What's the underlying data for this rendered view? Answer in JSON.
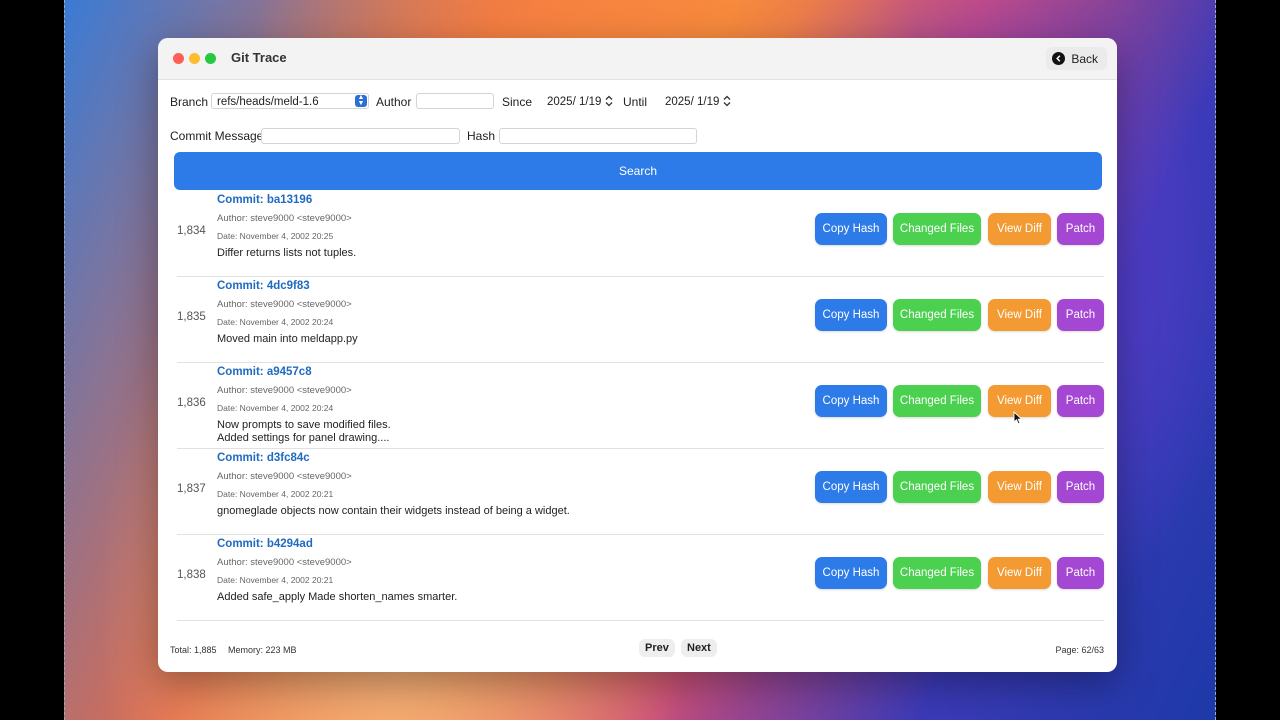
{
  "window": {
    "title": "Git Trace",
    "back_label": "Back"
  },
  "filters": {
    "branch_label": "Branch",
    "branch_value": "refs/heads/meld-1.6",
    "author_label": "Author",
    "author_value": "",
    "since_label": "Since",
    "since_value": "2025/  1/19",
    "until_label": "Until",
    "until_value": "2025/  1/19",
    "message_label": "Commit Message",
    "message_value": "",
    "hash_label": "Hash",
    "hash_value": ""
  },
  "search_label": "Search",
  "buttons": {
    "copy_hash": "Copy Hash",
    "changed_files": "Changed Files",
    "view_diff": "View Diff",
    "patch": "Patch"
  },
  "commits": [
    {
      "num": "1,834",
      "hash": "Commit: ba13196",
      "author": "Author: steve9000 <steve9000>",
      "date": "Date: November 4, 2002 20:25",
      "message": "Differ returns lists not tuples."
    },
    {
      "num": "1,835",
      "hash": "Commit: 4dc9f83",
      "author": "Author: steve9000 <steve9000>",
      "date": "Date: November 4, 2002 20:24",
      "message": "Moved main into meldapp.py"
    },
    {
      "num": "1,836",
      "hash": "Commit: a9457c8",
      "author": "Author: steve9000 <steve9000>",
      "date": "Date: November 4, 2002 20:24",
      "message": "Now prompts to save modified files.\nAdded settings for panel drawing...."
    },
    {
      "num": "1,837",
      "hash": "Commit: d3fc84c",
      "author": "Author: steve9000 <steve9000>",
      "date": "Date: November 4, 2002 20:21",
      "message": "gnomeglade objects now contain their widgets instead of being a widget."
    },
    {
      "num": "1,838",
      "hash": "Commit: b4294ad",
      "author": "Author: steve9000 <steve9000>",
      "date": "Date: November 4, 2002 20:21",
      "message": "Added safe_apply Made shorten_names smarter."
    }
  ],
  "footer": {
    "total": "Total: 1,885",
    "memory": "Memory: 223 MB",
    "prev_label": "Prev",
    "next_label": "Next",
    "page": "Page: 62/63"
  }
}
